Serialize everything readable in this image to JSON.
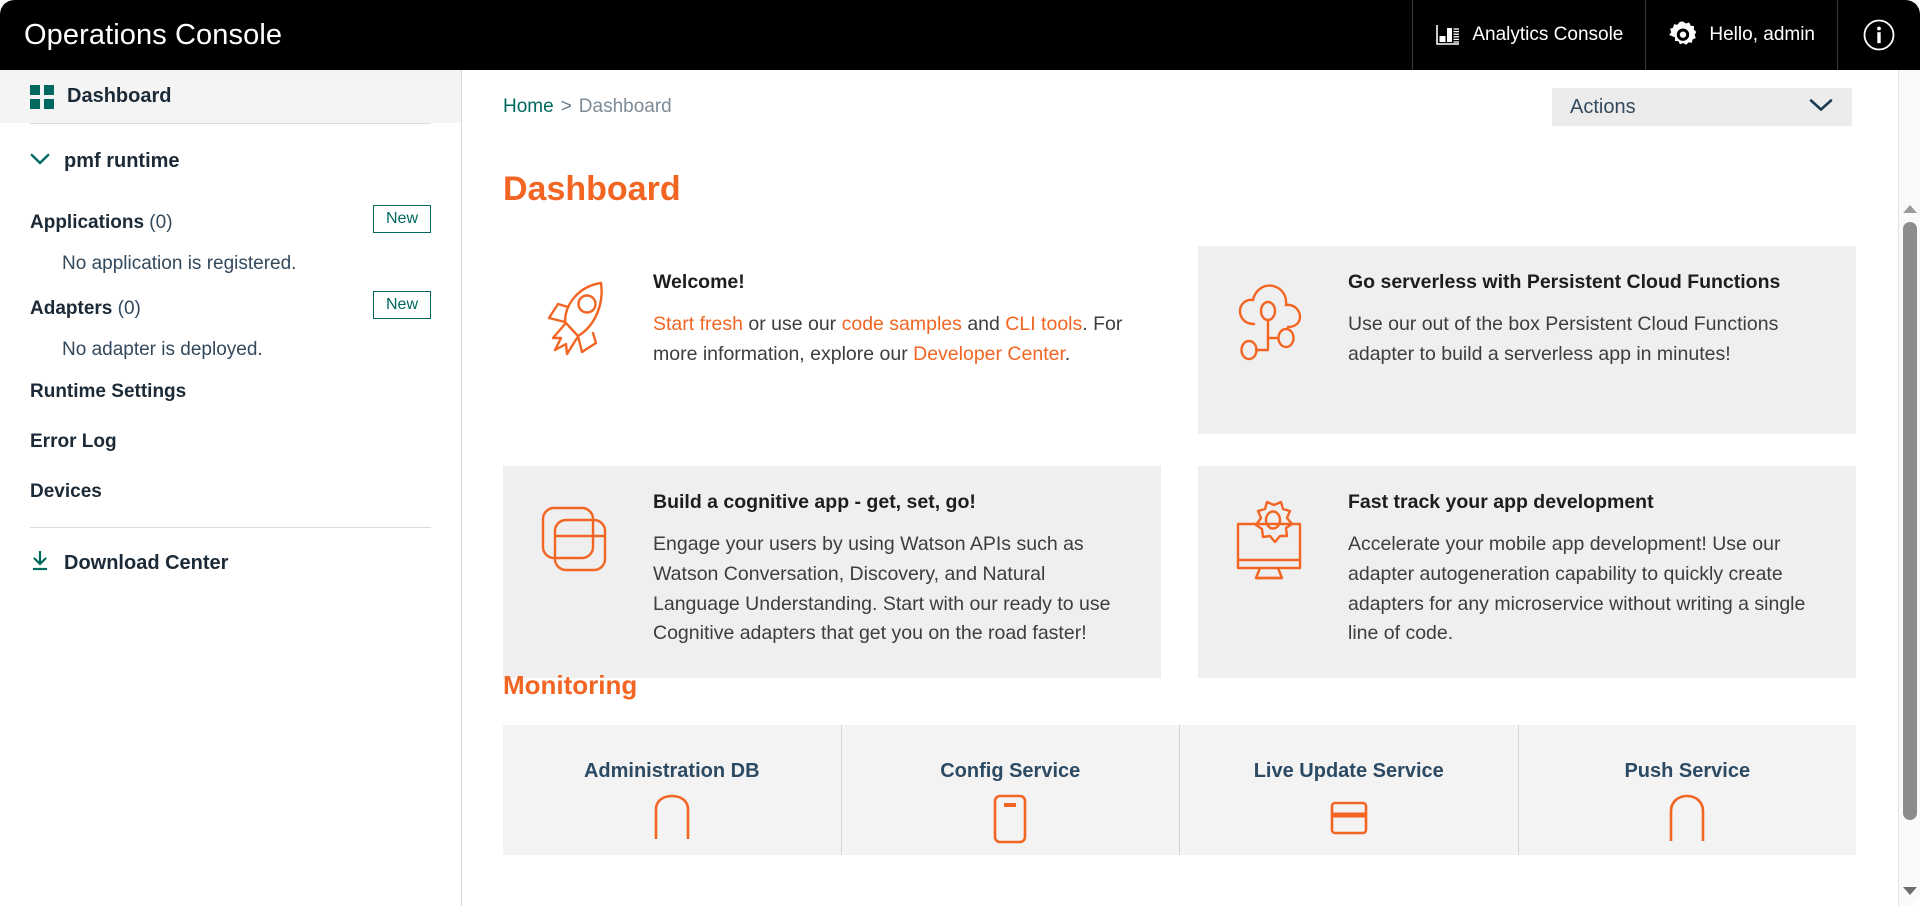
{
  "header": {
    "brand": "Operations Console",
    "analytics_label": "Analytics Console",
    "user_label": "Hello, admin",
    "info_label": "i",
    "bg": "#000000",
    "text": "#ffffff"
  },
  "sidebar": {
    "dashboard_label": "Dashboard",
    "runtime_label": "pmf runtime",
    "applications": {
      "label": "Applications",
      "count": "(0)",
      "new_label": "New",
      "empty_text": "No application is registered."
    },
    "adapters": {
      "label": "Adapters",
      "count": "(0)",
      "new_label": "New",
      "empty_text": "No adapter is deployed."
    },
    "nav_items": [
      {
        "label": "Runtime Settings"
      },
      {
        "label": "Error Log"
      },
      {
        "label": "Devices"
      }
    ],
    "download_center_label": "Download Center",
    "accent": "#00685e"
  },
  "breadcrumb": {
    "home": "Home",
    "separator": ">",
    "current": "Dashboard"
  },
  "actions": {
    "label": "Actions"
  },
  "page": {
    "title": "Dashboard",
    "accent": "#f26522"
  },
  "cards": [
    {
      "icon": "rocket-icon",
      "heading": "Welcome!",
      "style": "plain",
      "rich": [
        {
          "t": "Start fresh",
          "link": true
        },
        {
          "t": " or use our ",
          "link": false
        },
        {
          "t": "code samples",
          "link": true
        },
        {
          "t": " and ",
          "link": false
        },
        {
          "t": "CLI tools",
          "link": true
        },
        {
          "t": ". For more information, explore our ",
          "link": false
        },
        {
          "t": "Developer Center",
          "link": true
        },
        {
          "t": ".",
          "link": false
        }
      ]
    },
    {
      "icon": "cloud-function-icon",
      "heading": "Go serverless with Persistent Cloud Functions",
      "style": "filled",
      "body": "Use our out of the box Persistent Cloud Functions adapter to build a serverless app in minutes!"
    },
    {
      "icon": "stacked-cards-icon",
      "heading": "Build a cognitive app - get, set, go!",
      "style": "filled",
      "body": "Engage your users by using Watson APIs such as Watson Conversation, Discovery, and Natural Language Understanding. Start with our ready to use Cognitive adapters that get you on the road faster!"
    },
    {
      "icon": "monitor-gear-icon",
      "heading": "Fast track your app development",
      "style": "filled",
      "body": "Accelerate your mobile app development! Use our adapter autogeneration capability to quickly create adapters for any microservice without writing a single line of code."
    }
  ],
  "monitoring": {
    "title": "Monitoring",
    "services": [
      {
        "label": "Administration DB",
        "icon": "database-icon"
      },
      {
        "label": "Config Service",
        "icon": "config-icon"
      },
      {
        "label": "Live Update Service",
        "icon": "liveupdate-icon"
      },
      {
        "label": "Push Service",
        "icon": "push-icon"
      }
    ]
  }
}
